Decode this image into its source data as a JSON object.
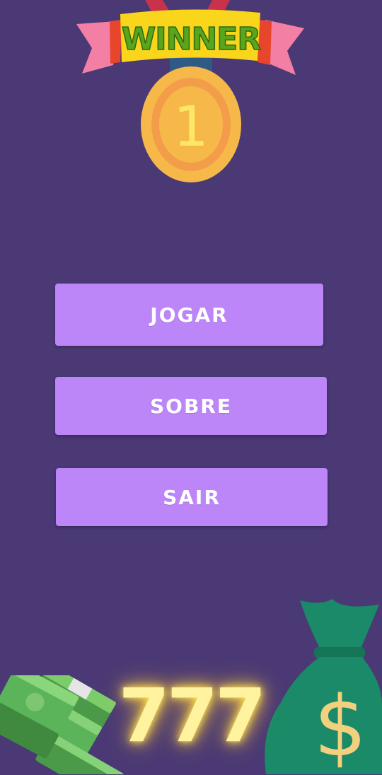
{
  "header": {
    "banner_text": "WINNER",
    "medal_number": "1"
  },
  "menu": {
    "play_label": "JOGAR",
    "about_label": "SOBRE",
    "exit_label": "SAIR"
  },
  "footer": {
    "jackpot_text": "777",
    "money_bag_symbol": "$"
  },
  "icons": [
    "medal-icon",
    "ribbon-banner-icon",
    "cash-stack-icon",
    "money-bag-icon"
  ],
  "colors": {
    "background": "#4a3975",
    "button": "#bc86f9",
    "button_text": "#ffffff",
    "medal": "#f7b84a",
    "banner": "#f9d51c",
    "banner_ribbon": "#f47fa4",
    "money_green": "#5bb35a",
    "bag_green": "#1a8a68",
    "jackpot_glow": "#ffe45c"
  }
}
